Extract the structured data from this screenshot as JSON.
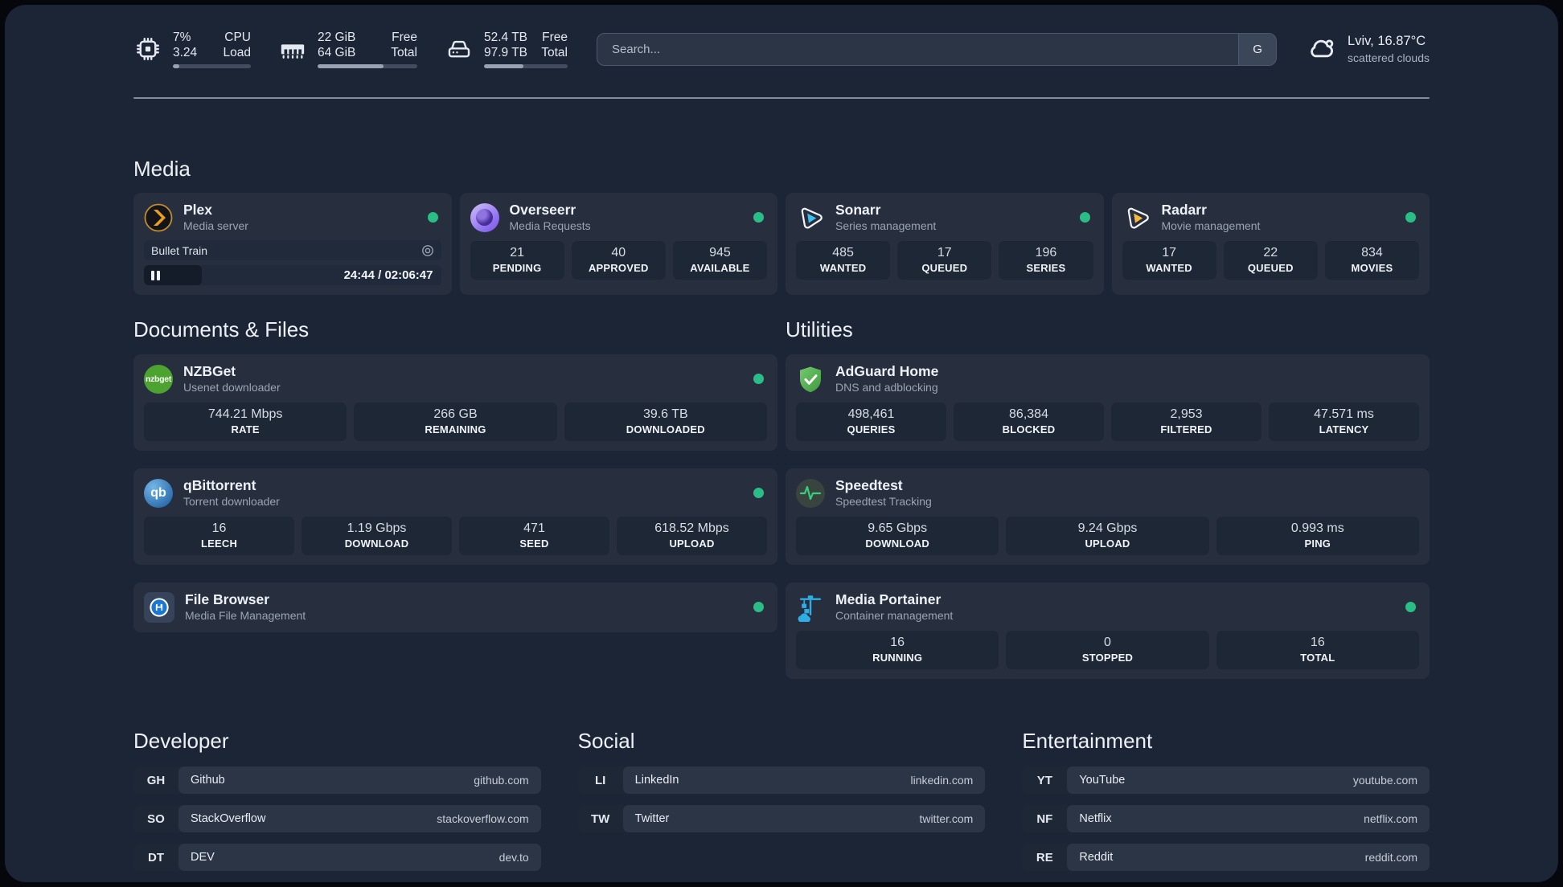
{
  "topbar": {
    "cpu": {
      "usage": "7%",
      "load": "3.24",
      "label_top": "CPU",
      "label_bottom": "Load",
      "progress_pct": 8
    },
    "memory": {
      "free": "22 GiB",
      "total": "64 GiB",
      "label_top": "Free",
      "label_bottom": "Total",
      "progress_pct": 66
    },
    "disk": {
      "free": "52.4 TB",
      "total": "97.9 TB",
      "label_top": "Free",
      "label_bottom": "Total",
      "progress_pct": 47
    },
    "search": {
      "placeholder": "Search...",
      "engine_label": "G"
    },
    "weather": {
      "location": "Lviv, 16.87°C",
      "condition": "scattered clouds"
    }
  },
  "sections": {
    "media": {
      "title": "Media",
      "plex": {
        "name": "Plex",
        "desc": "Media server",
        "online": true,
        "now_playing": "Bullet Train",
        "time_display": "24:44 / 02:06:47",
        "progress_pct": 19.5
      },
      "overseerr": {
        "name": "Overseerr",
        "desc": "Media Requests",
        "online": true,
        "stats": [
          {
            "value": "21",
            "label": "PENDING"
          },
          {
            "value": "40",
            "label": "APPROVED"
          },
          {
            "value": "945",
            "label": "AVAILABLE"
          }
        ]
      },
      "sonarr": {
        "name": "Sonarr",
        "desc": "Series management",
        "online": true,
        "stats": [
          {
            "value": "485",
            "label": "WANTED"
          },
          {
            "value": "17",
            "label": "QUEUED"
          },
          {
            "value": "196",
            "label": "SERIES"
          }
        ]
      },
      "radarr": {
        "name": "Radarr",
        "desc": "Movie management",
        "online": true,
        "stats": [
          {
            "value": "17",
            "label": "WANTED"
          },
          {
            "value": "22",
            "label": "QUEUED"
          },
          {
            "value": "834",
            "label": "MOVIES"
          }
        ]
      }
    },
    "documents": {
      "title": "Documents & Files",
      "nzbget": {
        "name": "NZBGet",
        "desc": "Usenet downloader",
        "online": true,
        "icon_text": "nzbget",
        "stats": [
          {
            "value": "744.21 Mbps",
            "label": "RATE"
          },
          {
            "value": "266 GB",
            "label": "REMAINING"
          },
          {
            "value": "39.6 TB",
            "label": "DOWNLOADED"
          }
        ]
      },
      "qbittorrent": {
        "name": "qBittorrent",
        "desc": "Torrent downloader",
        "online": true,
        "icon_text": "qb",
        "stats": [
          {
            "value": "16",
            "label": "LEECH"
          },
          {
            "value": "1.19 Gbps",
            "label": "DOWNLOAD"
          },
          {
            "value": "471",
            "label": "SEED"
          },
          {
            "value": "618.52 Mbps",
            "label": "UPLOAD"
          }
        ]
      },
      "filebrowser": {
        "name": "File Browser",
        "desc": "Media File Management",
        "online": true
      }
    },
    "utilities": {
      "title": "Utilities",
      "adguard": {
        "name": "AdGuard Home",
        "desc": "DNS and adblocking",
        "stats": [
          {
            "value": "498,461",
            "label": "QUERIES"
          },
          {
            "value": "86,384",
            "label": "BLOCKED"
          },
          {
            "value": "2,953",
            "label": "FILTERED"
          },
          {
            "value": "47.571 ms",
            "label": "LATENCY"
          }
        ]
      },
      "speedtest": {
        "name": "Speedtest",
        "desc": "Speedtest Tracking",
        "stats": [
          {
            "value": "9.65 Gbps",
            "label": "DOWNLOAD"
          },
          {
            "value": "9.24 Gbps",
            "label": "UPLOAD"
          },
          {
            "value": "0.993 ms",
            "label": "PING"
          }
        ]
      },
      "portainer": {
        "name": "Media Portainer",
        "desc": "Container management",
        "online": true,
        "stats": [
          {
            "value": "16",
            "label": "RUNNING"
          },
          {
            "value": "0",
            "label": "STOPPED"
          },
          {
            "value": "16",
            "label": "TOTAL"
          }
        ]
      }
    }
  },
  "bookmarks": [
    {
      "title": "Developer",
      "links": [
        {
          "abbr": "GH",
          "name": "Github",
          "url": "github.com"
        },
        {
          "abbr": "SO",
          "name": "StackOverflow",
          "url": "stackoverflow.com"
        },
        {
          "abbr": "DT",
          "name": "DEV",
          "url": "dev.to"
        }
      ]
    },
    {
      "title": "Social",
      "links": [
        {
          "abbr": "LI",
          "name": "LinkedIn",
          "url": "linkedin.com"
        },
        {
          "abbr": "TW",
          "name": "Twitter",
          "url": "twitter.com"
        }
      ]
    },
    {
      "title": "Entertainment",
      "links": [
        {
          "abbr": "YT",
          "name": "YouTube",
          "url": "youtube.com"
        },
        {
          "abbr": "NF",
          "name": "Netflix",
          "url": "netflix.com"
        },
        {
          "abbr": "RE",
          "name": "Reddit",
          "url": "reddit.com"
        }
      ]
    }
  ],
  "colors": {
    "status_online": "#2abd85",
    "accent_plex": "#e8a01c",
    "accent_sonarr": "#39c1f0",
    "accent_radarr": "#f6b93d"
  }
}
